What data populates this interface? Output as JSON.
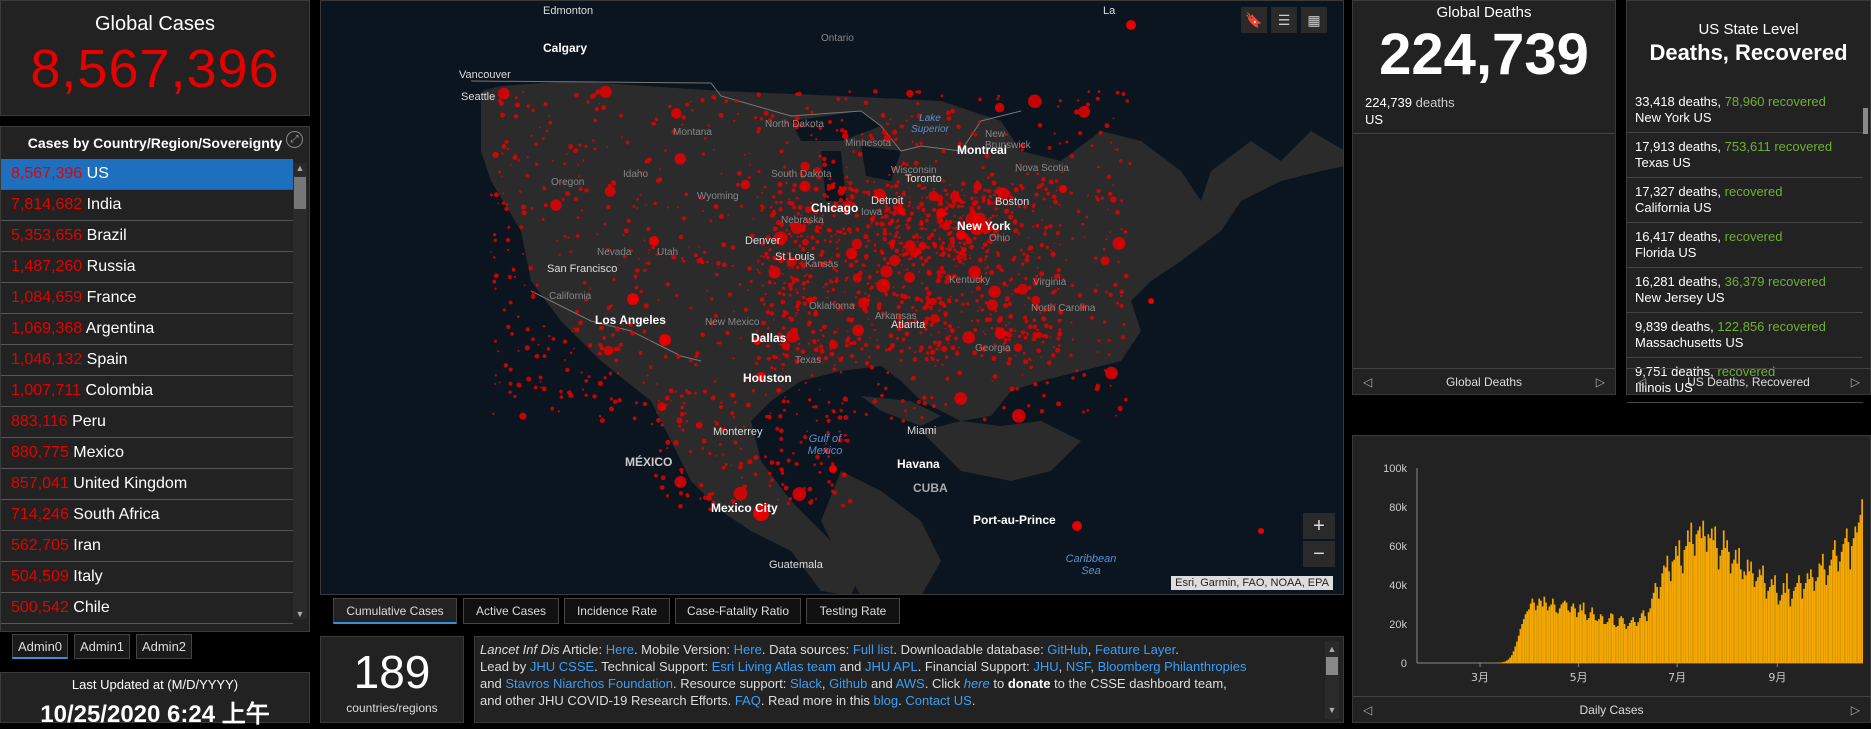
{
  "global_cases": {
    "label": "Global Cases",
    "value": "8,567,396"
  },
  "country_panel": {
    "header": "Cases by Country/Region/Sovereignty",
    "rows": [
      {
        "count": "8,567,396",
        "name": "US",
        "selected": true
      },
      {
        "count": "7,814,682",
        "name": "India"
      },
      {
        "count": "5,353,656",
        "name": "Brazil"
      },
      {
        "count": "1,487,260",
        "name": "Russia"
      },
      {
        "count": "1,084,659",
        "name": "France"
      },
      {
        "count": "1,069,368",
        "name": "Argentina"
      },
      {
        "count": "1,046,132",
        "name": "Spain"
      },
      {
        "count": "1,007,711",
        "name": "Colombia"
      },
      {
        "count": "883,116",
        "name": "Peru"
      },
      {
        "count": "880,775",
        "name": "Mexico"
      },
      {
        "count": "857,041",
        "name": "United Kingdom"
      },
      {
        "count": "714,246",
        "name": "South Africa"
      },
      {
        "count": "562,705",
        "name": "Iran"
      },
      {
        "count": "504,509",
        "name": "Italy"
      },
      {
        "count": "500,542",
        "name": "Chile"
      }
    ]
  },
  "admin_tabs": [
    "Admin0",
    "Admin1",
    "Admin2"
  ],
  "last_updated": {
    "label": "Last Updated at (M/D/YYYY)",
    "value": "10/25/2020 6:24 上午"
  },
  "map": {
    "attribution": "Esri, Garmin, FAO, NOAA, EPA",
    "zoom_in": "+",
    "zoom_out": "−",
    "labels": {
      "edmonton": "Edmonton",
      "calgary": "Calgary",
      "vancouver": "Vancouver",
      "seattle": "Seattle",
      "ontario": "Ontario",
      "montreal": "Montreal",
      "toronto": "Toronto",
      "chicago": "Chicago",
      "detroit": "Detroit",
      "new_york": "New York",
      "boston": "Boston",
      "denver": "Denver",
      "st_louis": "St Louis",
      "san_francisco": "San Francisco",
      "los_angeles": "Los Angeles",
      "dallas": "Dallas",
      "houston": "Houston",
      "atlanta": "Atlanta",
      "miami": "Miami",
      "monterrey": "Monterrey",
      "mexico": "MÉXICO",
      "mexico_city": "Mexico City",
      "havana": "Havana",
      "cuba": "CUBA",
      "port_au_prince": "Port-au-Prince",
      "guatemala": "Guatemala",
      "gulf_of_mexico": "Gulf of Mexico",
      "caribbean_sea": "Caribbean Sea",
      "lake_superior": "Lake Superior",
      "new_brunswick": "New Brunswick",
      "nova_scotia": "Nova Scotia",
      "montana": "Montana",
      "north_dakota": "North Dakota",
      "minnesota": "Minnesota",
      "wisconsin": "Wisconsin",
      "south_dakota": "South Dakota",
      "oregon": "Oregon",
      "idaho": "Idaho",
      "wyoming": "Wyoming",
      "nebraska": "Nebraska",
      "iowa": "Iowa",
      "ohio": "Ohio",
      "nevada": "Nevada",
      "utah": "Utah",
      "kansas": "Kansas",
      "kentucky": "Kentucky",
      "virginia": "Virginia",
      "california": "California",
      "oklahoma": "Oklahoma",
      "arkansas": "Arkansas",
      "north_carolina": "North Carolina",
      "new_mexico": "New Mexico",
      "texas": "Texas",
      "georgia": "Georgia",
      "la": "La"
    }
  },
  "bottom_tabs": [
    "Cumulative Cases",
    "Active Cases",
    "Incidence Rate",
    "Case-Fatality Ratio",
    "Testing Rate"
  ],
  "countries_count": {
    "value": "189",
    "label": "countries/regions"
  },
  "info": {
    "l1_a": "Lancet Inf Dis",
    "l1_b": " Article: ",
    "here1": "Here",
    "l1_c": ". Mobile Version: ",
    "here2": "Here",
    "l1_d": ". Data sources: ",
    "full_list": "Full list",
    "l1_e": ". Downloadable database: ",
    "github": "GitHub",
    "comma": ", ",
    "feature_layer": "Feature Layer",
    "dot": ".",
    "l2_a": "Lead by ",
    "jhu_csse": "JHU CSSE",
    "l2_b": ". Technical Support: ",
    "esri": "Esri Living Atlas team",
    "and1": " and ",
    "jhu_apl": "JHU APL",
    "l2_c": ". Financial Support: ",
    "jhu": "JHU",
    "nsf": "NSF",
    "bloomberg": "Bloomberg Philanthropies",
    "l3_a": "and ",
    "stavros": "Stavros Niarchos Foundation",
    "l3_b": ". Resource support: ",
    "slack": "Slack",
    "github2": "Github",
    "and2": " and ",
    "aws": "AWS",
    "l3_c": ". Click ",
    "here3": "here",
    "l3_d": " to ",
    "donate": "donate",
    "l3_e": " to the CSSE dashboard team,",
    "l4_a": "and other JHU COVID-19 Research Efforts. ",
    "faq": "FAQ",
    "l4_b": ". Read more in this ",
    "blog": "blog",
    "l4_c": ". ",
    "contact": "Contact US",
    "l4_d": "."
  },
  "global_deaths": {
    "label": "Global Deaths",
    "value": "224,739",
    "detail_count": "224,739",
    "detail_unit": " deaths",
    "detail_place": "US",
    "nav_label": "Global Deaths"
  },
  "us_states": {
    "title_1": "US State Level",
    "title_2": "Deaths, Recovered",
    "nav_label": "US Deaths, Recovered",
    "rows": [
      {
        "deaths": "33,418 deaths,",
        "recovered_num": "78,960",
        "recovered_word": "recovered",
        "place": "New York US"
      },
      {
        "deaths": "17,913 deaths,",
        "recovered_num": "753,611",
        "recovered_word": "recovered",
        "place": "Texas US"
      },
      {
        "deaths": "17,327 deaths,",
        "recovered_num": "",
        "recovered_word": "recovered",
        "place": "California US"
      },
      {
        "deaths": "16,417 deaths,",
        "recovered_num": "",
        "recovered_word": "recovered",
        "place": "Florida US"
      },
      {
        "deaths": "16,281 deaths,",
        "recovered_num": "36,379",
        "recovered_word": "recovered",
        "place": "New Jersey US"
      },
      {
        "deaths": "9,839 deaths,",
        "recovered_num": "122,856",
        "recovered_word": "recovered",
        "place": "Massachusetts US"
      },
      {
        "deaths": "9,751 deaths,",
        "recovered_num": "",
        "recovered_word": "recovered",
        "place": "Illinois US"
      }
    ]
  },
  "chart_data": {
    "type": "bar",
    "title": "",
    "xlabel": "Daily Cases",
    "ylabel": "",
    "ylim": [
      0,
      100000
    ],
    "yticks": [
      "0",
      "20k",
      "40k",
      "60k",
      "80k",
      "100k"
    ],
    "xticks": [
      "3月",
      "5月",
      "7月",
      "9月"
    ],
    "color": "#f5a800",
    "grid": false,
    "x_start": "2020-01-22",
    "x_end": "2020-10-24",
    "values": [
      0,
      0,
      0,
      0,
      0,
      0,
      0,
      0,
      0,
      0,
      0,
      0,
      0,
      0,
      0,
      0,
      0,
      0,
      0,
      0,
      0,
      0,
      0,
      0,
      0,
      0,
      0,
      0,
      0,
      0,
      0,
      0,
      0,
      0,
      0,
      0,
      0,
      0,
      0,
      0,
      0,
      0,
      0,
      10,
      20,
      30,
      60,
      100,
      200,
      300,
      500,
      700,
      1200,
      1800,
      2800,
      4000,
      6000,
      8500,
      11000,
      14000,
      17500,
      20000,
      22500,
      25000,
      26500,
      27500,
      30500,
      33000,
      31000,
      27000,
      29500,
      33000,
      32000,
      29000,
      34000,
      31000,
      27000,
      29000,
      30000,
      33000,
      30000,
      26000,
      25500,
      28000,
      30000,
      31000,
      32000,
      31000,
      27000,
      26000,
      29000,
      30500,
      28000,
      23500,
      26000,
      30000,
      27000,
      31000,
      25000,
      22000,
      23000,
      26000,
      28500,
      25000,
      22000,
      21500,
      22500,
      25000,
      24000,
      20000,
      20000,
      21000,
      23000,
      25500,
      25000,
      19500,
      18500,
      19000,
      23000,
      24000,
      23000,
      20000,
      17500,
      19000,
      20500,
      22000,
      23500,
      21000,
      19000,
      21000,
      23000,
      25500,
      27000,
      24000,
      21500,
      26000,
      28000,
      33000,
      36000,
      41000,
      39000,
      33000,
      39000,
      46000,
      50000,
      49000,
      55000,
      47000,
      42000,
      52000,
      53000,
      60000,
      55000,
      63000,
      50000,
      46000,
      58000,
      60000,
      68000,
      62000,
      72000,
      61000,
      55000,
      66000,
      68000,
      70000,
      64000,
      73000,
      65000,
      57000,
      66000,
      64000,
      69000,
      63000,
      70000,
      59000,
      48000,
      55000,
      58000,
      68000,
      59000,
      63000,
      57000,
      46000,
      51000,
      53000,
      58000,
      51000,
      59000,
      48000,
      43000,
      47000,
      45000,
      53000,
      47000,
      52000,
      46000,
      39000,
      42000,
      44000,
      48000,
      45000,
      50000,
      41000,
      33000,
      37000,
      39000,
      43000,
      40000,
      45000,
      36000,
      30000,
      32000,
      35000,
      41000,
      36000,
      46000,
      38000,
      29000,
      33000,
      37000,
      39000,
      41000,
      45000,
      41000,
      33000,
      38000,
      41000,
      46000,
      43000,
      48000,
      44000,
      37000,
      42000,
      44000,
      51000,
      50000,
      56000,
      48000,
      40000,
      45000,
      50000,
      53000,
      58000,
      63000,
      55000,
      47000,
      52000,
      57000,
      61000,
      64000,
      69000,
      62000,
      48000,
      60000,
      64000,
      70000,
      67000,
      72000,
      76000,
      84000
    ]
  }
}
